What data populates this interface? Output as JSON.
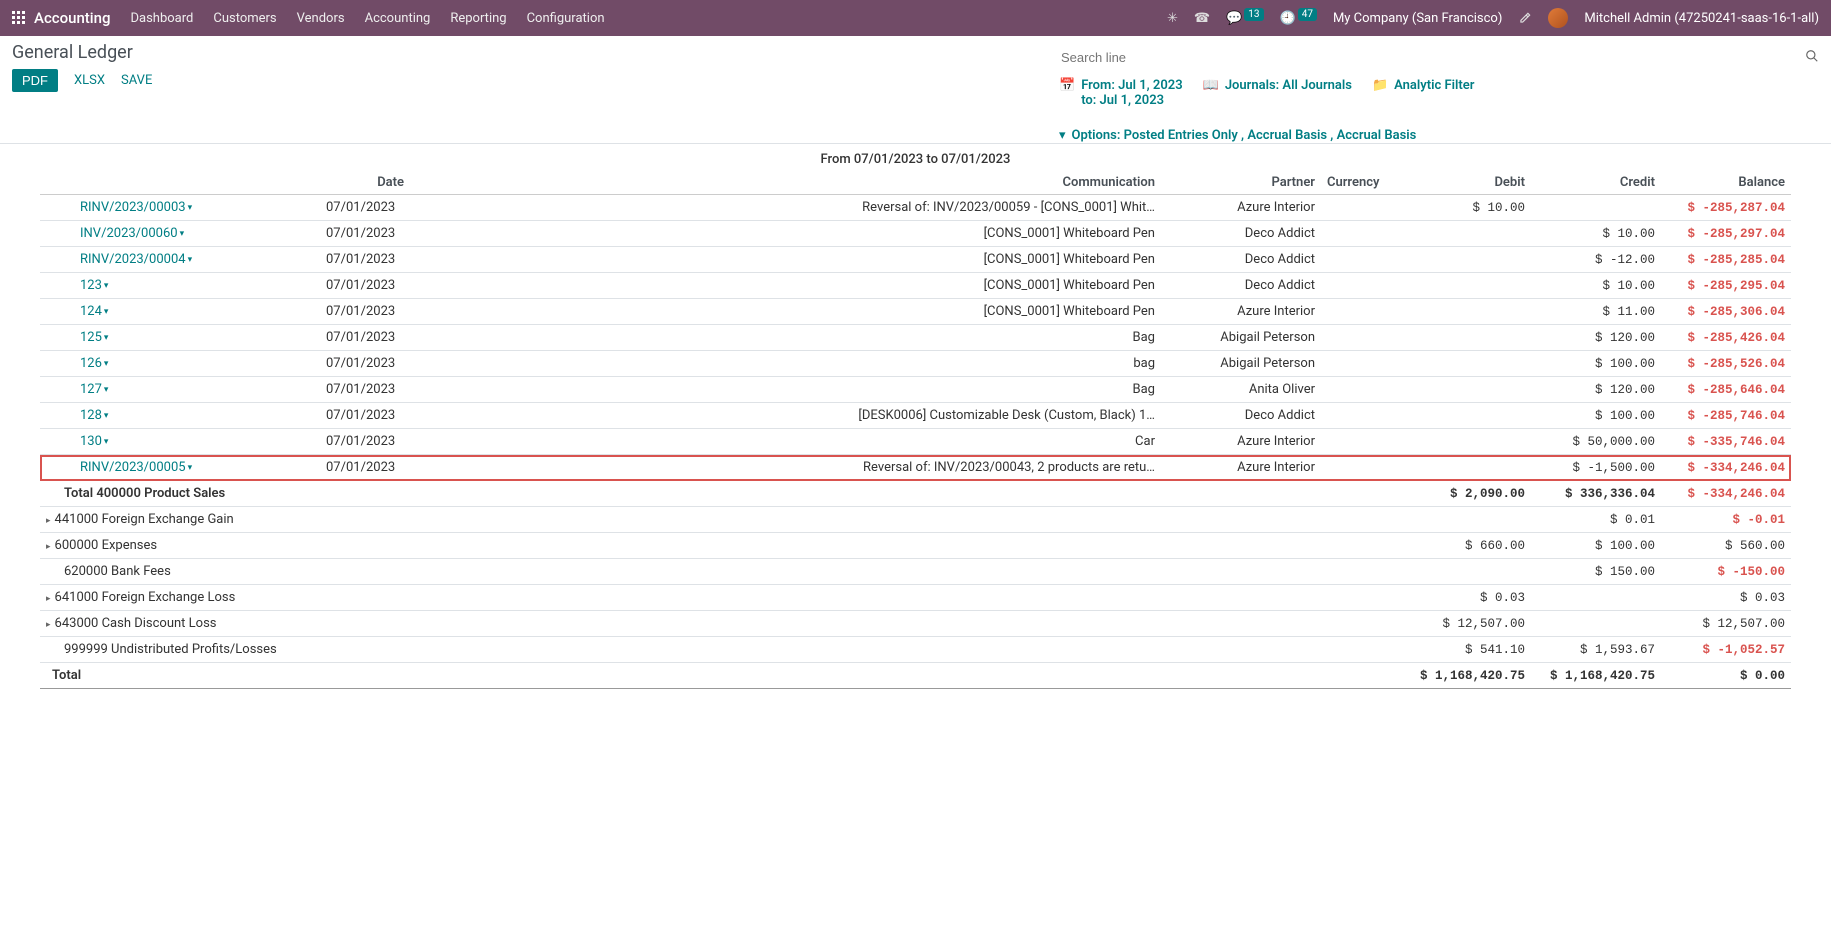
{
  "topbar": {
    "brand": "Accounting",
    "menu": [
      "Dashboard",
      "Customers",
      "Vendors",
      "Accounting",
      "Reporting",
      "Configuration"
    ],
    "msg_count": "13",
    "activity_count": "47",
    "company": "My Company (San Francisco)",
    "user": "Mitchell Admin (47250241-saas-16-1-all)"
  },
  "page": {
    "title": "General Ledger",
    "btn_pdf": "PDF",
    "btn_xlsx": "XLSX",
    "btn_save": "SAVE",
    "search_placeholder": "Search line",
    "period_title": "From 07/01/2023 to 07/01/2023"
  },
  "filters": {
    "date": {
      "line1": "From: Jul 1, 2023",
      "line2": "to: Jul 1, 2023"
    },
    "journals": "Journals: All Journals",
    "analytic": "Analytic Filter",
    "options": "Options: Posted Entries Only , Accrual Basis , Accrual Basis"
  },
  "columns": {
    "date": "Date",
    "comm": "Communication",
    "partner": "Partner",
    "currency": "Currency",
    "debit": "Debit",
    "credit": "Credit",
    "balance": "Balance"
  },
  "lines": [
    {
      "entry": "RINV/2023/00003",
      "date": "07/01/2023",
      "comm": "Reversal of: INV/2023/00059 - [CONS_0001] Whit…",
      "partner": "Azure Interior",
      "debit": "$ 10.00",
      "credit": "",
      "balance": "$ -285,287.04",
      "bal_neg": true
    },
    {
      "entry": "INV/2023/00060",
      "date": "07/01/2023",
      "comm": "[CONS_0001] Whiteboard Pen",
      "partner": "Deco Addict",
      "debit": "",
      "credit": "$ 10.00",
      "balance": "$ -285,297.04",
      "bal_neg": true
    },
    {
      "entry": "RINV/2023/00004",
      "date": "07/01/2023",
      "comm": "[CONS_0001] Whiteboard Pen",
      "partner": "Deco Addict",
      "debit": "",
      "credit": "$ -12.00",
      "balance": "$ -285,285.04",
      "bal_neg": true
    },
    {
      "entry": "123",
      "date": "07/01/2023",
      "comm": "[CONS_0001] Whiteboard Pen",
      "partner": "Deco Addict",
      "debit": "",
      "credit": "$ 10.00",
      "balance": "$ -285,295.04",
      "bal_neg": true
    },
    {
      "entry": "124",
      "date": "07/01/2023",
      "comm": "[CONS_0001] Whiteboard Pen",
      "partner": "Azure Interior",
      "debit": "",
      "credit": "$ 11.00",
      "balance": "$ -285,306.04",
      "bal_neg": true
    },
    {
      "entry": "125",
      "date": "07/01/2023",
      "comm": "Bag",
      "partner": "Abigail Peterson",
      "debit": "",
      "credit": "$ 120.00",
      "balance": "$ -285,426.04",
      "bal_neg": true
    },
    {
      "entry": "126",
      "date": "07/01/2023",
      "comm": "bag",
      "partner": "Abigail Peterson",
      "debit": "",
      "credit": "$ 100.00",
      "balance": "$ -285,526.04",
      "bal_neg": true
    },
    {
      "entry": "127",
      "date": "07/01/2023",
      "comm": "Bag",
      "partner": "Anita Oliver",
      "debit": "",
      "credit": "$ 120.00",
      "balance": "$ -285,646.04",
      "bal_neg": true
    },
    {
      "entry": "128",
      "date": "07/01/2023",
      "comm": "[DESK0006] Customizable Desk (Custom, Black) 1…",
      "partner": "Deco Addict",
      "debit": "",
      "credit": "$ 100.00",
      "balance": "$ -285,746.04",
      "bal_neg": true
    },
    {
      "entry": "130",
      "date": "07/01/2023",
      "comm": "Car",
      "partner": "Azure Interior",
      "debit": "",
      "credit": "$ 50,000.00",
      "balance": "$ -335,746.04",
      "bal_neg": true
    },
    {
      "entry": "RINV/2023/00005",
      "date": "07/01/2023",
      "comm": "Reversal of: INV/2023/00043, 2 products are retu…",
      "partner": "Azure Interior",
      "debit": "",
      "credit": "$ -1,500.00",
      "balance": "$ -334,246.04",
      "bal_neg": true,
      "highlight": true
    }
  ],
  "subtotal": {
    "label": "Total 400000 Product Sales",
    "debit": "$ 2,090.00",
    "credit": "$ 336,336.04",
    "balance": "$ -334,246.04",
    "bal_neg": true
  },
  "accounts": [
    {
      "label": "441000 Foreign Exchange Gain",
      "debit": "",
      "credit": "$ 0.01",
      "balance": "$ -0.01",
      "bal_neg": true,
      "expandable": true
    },
    {
      "label": "600000 Expenses",
      "debit": "$ 660.00",
      "credit": "$ 100.00",
      "balance": "$ 560.00",
      "expandable": true
    },
    {
      "label": "620000 Bank Fees",
      "debit": "",
      "credit": "$ 150.00",
      "balance": "$ -150.00",
      "bal_neg": true,
      "expandable": false
    },
    {
      "label": "641000 Foreign Exchange Loss",
      "debit": "$ 0.03",
      "credit": "",
      "balance": "$ 0.03",
      "expandable": true
    },
    {
      "label": "643000 Cash Discount Loss",
      "debit": "$ 12,507.00",
      "credit": "",
      "balance": "$ 12,507.00",
      "expandable": true
    },
    {
      "label": "999999 Undistributed Profits/Losses",
      "debit": "$ 541.10",
      "credit": "$ 1,593.67",
      "balance": "$ -1,052.57",
      "bal_neg": true,
      "expandable": false
    }
  ],
  "total": {
    "label": "Total",
    "debit": "$ 1,168,420.75",
    "credit": "$ 1,168,420.75",
    "balance": "$ 0.00"
  }
}
